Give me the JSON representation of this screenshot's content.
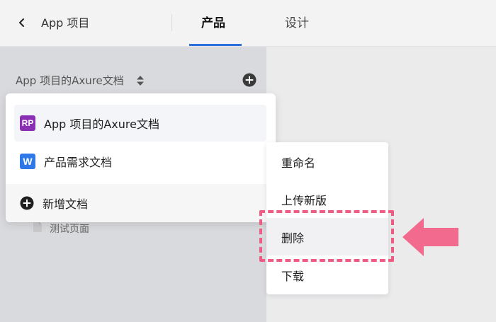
{
  "topbar": {
    "back_icon": "chevron-left-icon",
    "app_title": "App 项目",
    "tabs": [
      {
        "label": "产品",
        "active": true
      },
      {
        "label": "设计",
        "active": false
      }
    ],
    "accent_color": "#2f6fdf"
  },
  "sidebar": {
    "project_selector_label": "App 项目的Axure文档",
    "sort_icon": "sort-updown-icon",
    "add_icon": "add-circle-icon",
    "page_item": {
      "icon": "page-icon",
      "label": "测试页面"
    }
  },
  "doc_dropdown": {
    "items": [
      {
        "badge": "RP",
        "label": "App 项目的Axure文档",
        "selected": true,
        "badge_color": "#8a2fb3"
      },
      {
        "badge": "W",
        "label": "产品需求文档",
        "selected": false,
        "badge_color": "#2f78e8"
      }
    ],
    "footer": {
      "icon": "add-circle-icon",
      "label": "新增文档"
    }
  },
  "context_menu": {
    "items": [
      {
        "label": "重命名"
      },
      {
        "label": "上传新版"
      },
      {
        "label": "删除",
        "highlighted": true
      },
      {
        "label": "下载"
      }
    ]
  },
  "annotation": {
    "highlight_color": "#ee5c84",
    "arrow_icon": "left-arrow-icon"
  }
}
